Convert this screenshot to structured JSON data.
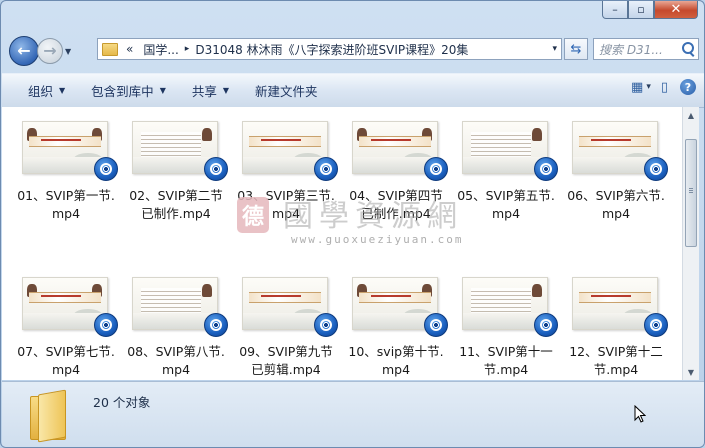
{
  "window": {
    "minimize_glyph": "–",
    "maximize_glyph": "▫",
    "close_glyph": "✕"
  },
  "address_bar": {
    "overflow_chevrons": "«",
    "crumbs": [
      "国学...",
      "D31048 林沐雨《八字探索进阶班SVIP课程》20集"
    ],
    "separator": "▸",
    "dropdown_glyph": "▾",
    "refresh_glyph": "⇆"
  },
  "search": {
    "placeholder": "搜索 D31..."
  },
  "toolbar": {
    "organize": "组织",
    "include_in_library": "包含到库中",
    "share": "共享",
    "new_folder": "新建文件夹",
    "caret": "▼",
    "view_icon": "▦",
    "view_caret": "▾",
    "pane_icon": "▯",
    "help_icon": "?"
  },
  "files": [
    {
      "label": "01、SVIP第一节.\nmp4"
    },
    {
      "label": "02、SVIP第二节\n已制作.mp4"
    },
    {
      "label": "03、SVIP第三节.\nmp4"
    },
    {
      "label": "04、SVIP第四节\n已制作.mp4"
    },
    {
      "label": "05、SVIP第五节.\nmp4"
    },
    {
      "label": "06、SVIP第六节.\nmp4"
    },
    {
      "label": "07、SVIP第七节.\nmp4"
    },
    {
      "label": "08、SVIP第八节.\nmp4"
    },
    {
      "label": "09、SVIP第九节\n已剪辑.mp4"
    },
    {
      "label": "10、svip第十节.\nmp4"
    },
    {
      "label": "11、SVIP第十一\n节.mp4"
    },
    {
      "label": "12、SVIP第十二\n节.mp4"
    }
  ],
  "watermark": {
    "seal": "德",
    "title": "國學資源網",
    "url": "www.guoxueziyuan.com"
  },
  "scrollbar": {
    "up": "▲",
    "down": "▼"
  },
  "status": {
    "count_text": "20 个对象"
  }
}
